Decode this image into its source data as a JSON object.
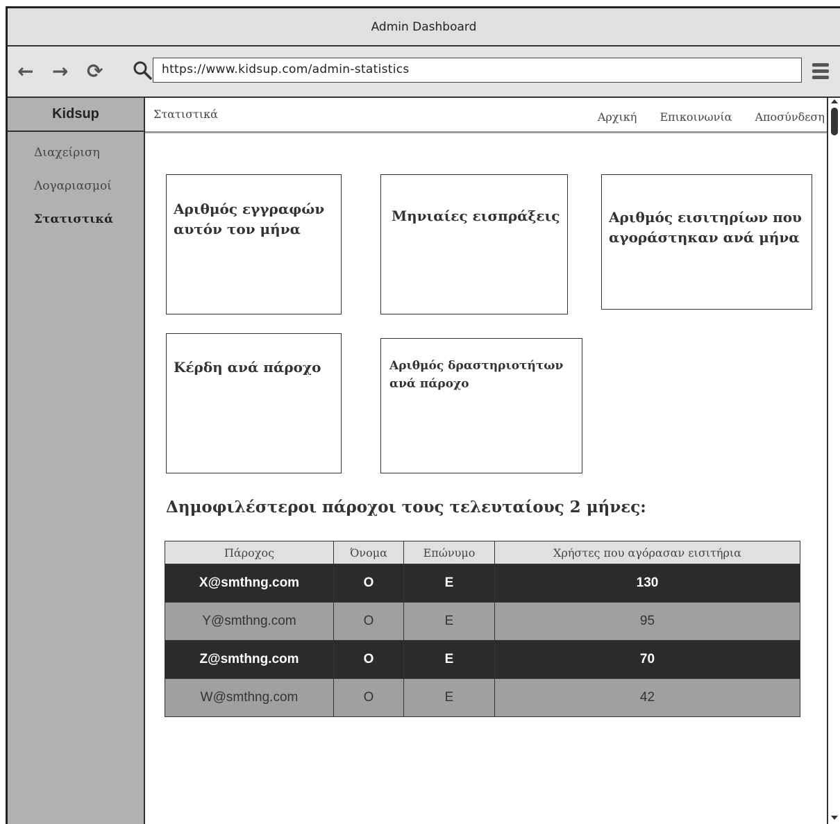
{
  "window": {
    "title": "Admin Dashboard"
  },
  "browser": {
    "back_icon": "←",
    "forward_icon": "→",
    "reload_icon": "⟳",
    "url": "https://www.kidsup.com/admin-statistics"
  },
  "sidebar": {
    "brand": "Kidsup",
    "items": [
      {
        "label": "Διαχείριση",
        "active": false
      },
      {
        "label": "Λογαριασμοί",
        "active": false
      },
      {
        "label": "Στατιστικά",
        "active": true
      }
    ]
  },
  "topnav": {
    "current": "Στατιστικά",
    "links": [
      "Αρχική",
      "Επικοινωνία",
      "Αποσύνδεση"
    ]
  },
  "cards": [
    "Αριθμός εγγραφών αυτόν τον μήνα",
    "Μηνιαίες εισπράξεις",
    "Αριθμός εισιτηρίων που αγοράστηκαν ανά μήνα",
    "Κέρδη ανά πάροχο",
    "Αριθμός δραστηριοτήτων ανά πάροχο"
  ],
  "table": {
    "title": "Δημοφιλέστεροι πάροχοι τους τελευταίους 2 μήνες:",
    "headers": [
      "Πάροχος",
      "Όνομα",
      "Επώνυμο",
      "Χρήστες που αγόρασαν εισιτήρια"
    ],
    "rows": [
      [
        "X@smthng.com",
        "O",
        "E",
        "130"
      ],
      [
        "Y@smthng.com",
        "O",
        "E",
        "95"
      ],
      [
        "Z@smthng.com",
        "O",
        "E",
        "70"
      ],
      [
        "W@smthng.com",
        "O",
        "E",
        "42"
      ]
    ]
  }
}
